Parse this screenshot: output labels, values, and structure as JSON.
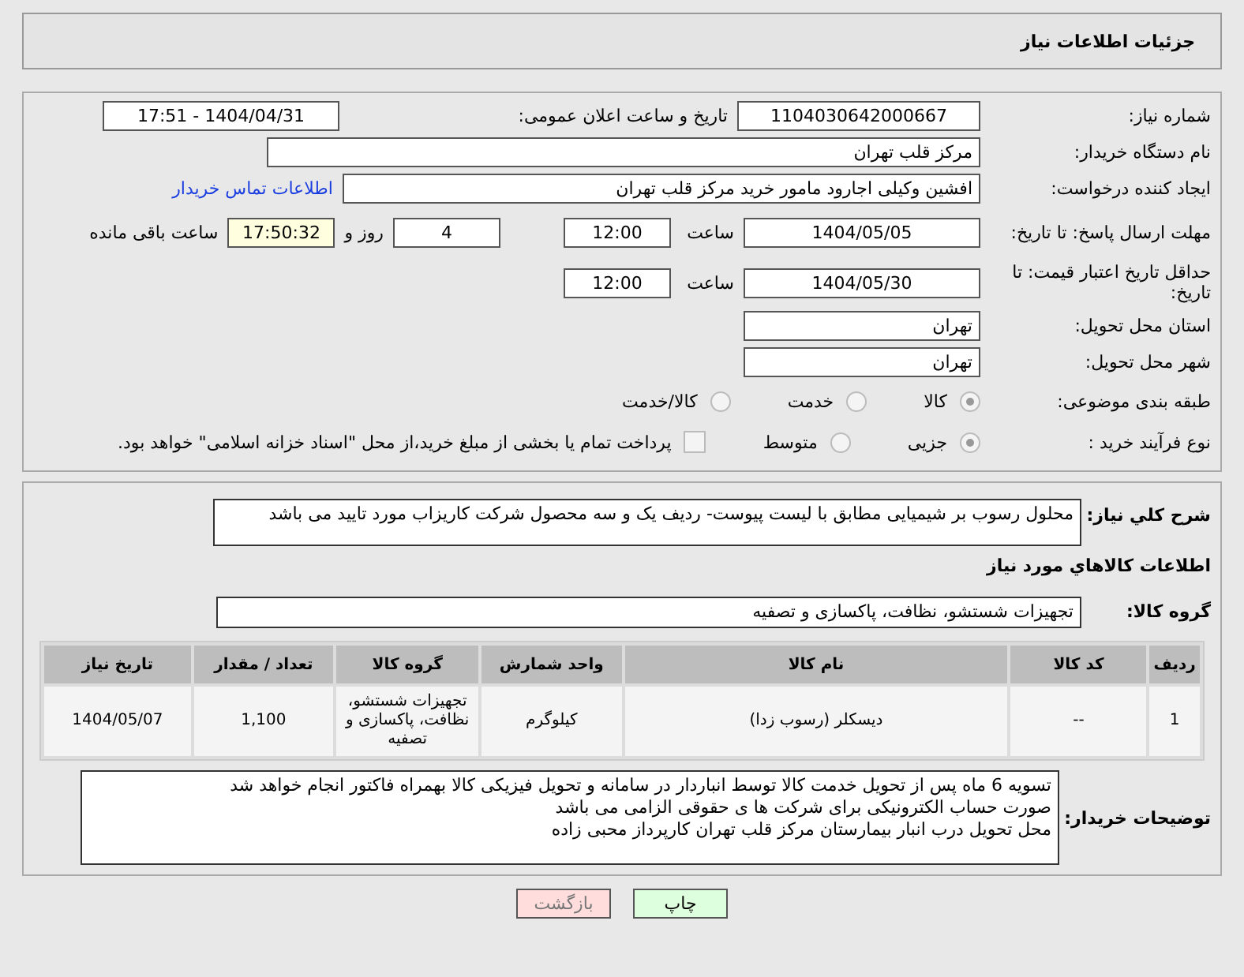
{
  "header": {
    "title": "جزئیات اطلاعات نیاز"
  },
  "need_number": {
    "label": "شماره نیاز:",
    "value": "1104030642000667"
  },
  "announce": {
    "label": "تاریخ و ساعت اعلان عمومی:",
    "value": "1404/04/31 - 17:51"
  },
  "buyer_org": {
    "label": "نام دستگاه خریدار:",
    "value": "مرکز قلب تهران"
  },
  "requester": {
    "label": "ایجاد کننده درخواست:",
    "value": "افشین وکیلی اجارود مامور خرید مرکز قلب تهران",
    "link": "اطلاعات تماس خریدار"
  },
  "deadline": {
    "label": "مهلت ارسال پاسخ: تا تاریخ:",
    "date": "1404/05/05",
    "time_label": "ساعت",
    "time": "12:00",
    "days": "4",
    "days_label": "روز و",
    "remaining": "17:50:32",
    "remaining_label": "ساعت باقی مانده"
  },
  "price_validity": {
    "label": "حداقل تاریخ اعتبار قیمت: تا تاریخ:",
    "date": "1404/05/30",
    "time_label": "ساعت",
    "time": "12:00"
  },
  "province": {
    "label": "استان محل تحویل:",
    "value": "تهران"
  },
  "city": {
    "label": "شهر محل تحویل:",
    "value": "تهران"
  },
  "category": {
    "label": "طبقه بندی موضوعی:",
    "options": [
      {
        "label": "کالا",
        "selected": true
      },
      {
        "label": "خدمت",
        "selected": false
      },
      {
        "label": "کالا/خدمت",
        "selected": false
      }
    ]
  },
  "process": {
    "label": "نوع فرآیند خرید :",
    "options": [
      {
        "label": "جزیی",
        "selected": true
      },
      {
        "label": "متوسط",
        "selected": false
      }
    ],
    "treasury": {
      "checked": false,
      "text": "پرداخت تمام یا بخشی از مبلغ خرید،از محل \"اسناد خزانه اسلامی\" خواهد بود."
    }
  },
  "description": {
    "label": "شرح کلي نياز:",
    "value": "محلول رسوب بر شیمیایی مطابق با لیست پیوست- ردیف یک و سه محصول شرکت کاریزاب مورد تایید می باشد"
  },
  "goods_title": "اطلاعات کالاهاي مورد نياز",
  "goods_group": {
    "label": "گروه کالا:",
    "value": "تجهیزات شستشو، نظافت، پاکسازی و تصفیه"
  },
  "table": {
    "columns": [
      "ردیف",
      "کد کالا",
      "نام کالا",
      "واحد شمارش",
      "گروه کالا",
      "تعداد / مقدار",
      "تاریخ نیاز"
    ],
    "rows": [
      [
        "1",
        "--",
        "دیسکلر (رسوب زدا)",
        "کیلوگرم",
        "تجهیزات شستشو، نظافت، پاکسازی و تصفیه",
        "1,100",
        "1404/05/07"
      ]
    ]
  },
  "buyer_notes": {
    "label": "توضیحات خریدار:",
    "lines": [
      "تسویه 6 ماه پس از تحویل خدمت کالا توسط انباردار در سامانه و تحویل فیزیکی کالا بهمراه فاکتور انجام خواهد شد",
      "صورت حساب الکترونیکی برای شرکت ها ی حقوقی الزامی می باشد",
      "محل تحویل درب انبار بیمارستان مرکز قلب تهران کارپرداز محبی زاده"
    ]
  },
  "buttons": [
    {
      "kind": "print",
      "label": "چاپ"
    },
    {
      "kind": "back",
      "label": "بازگشت"
    }
  ]
}
